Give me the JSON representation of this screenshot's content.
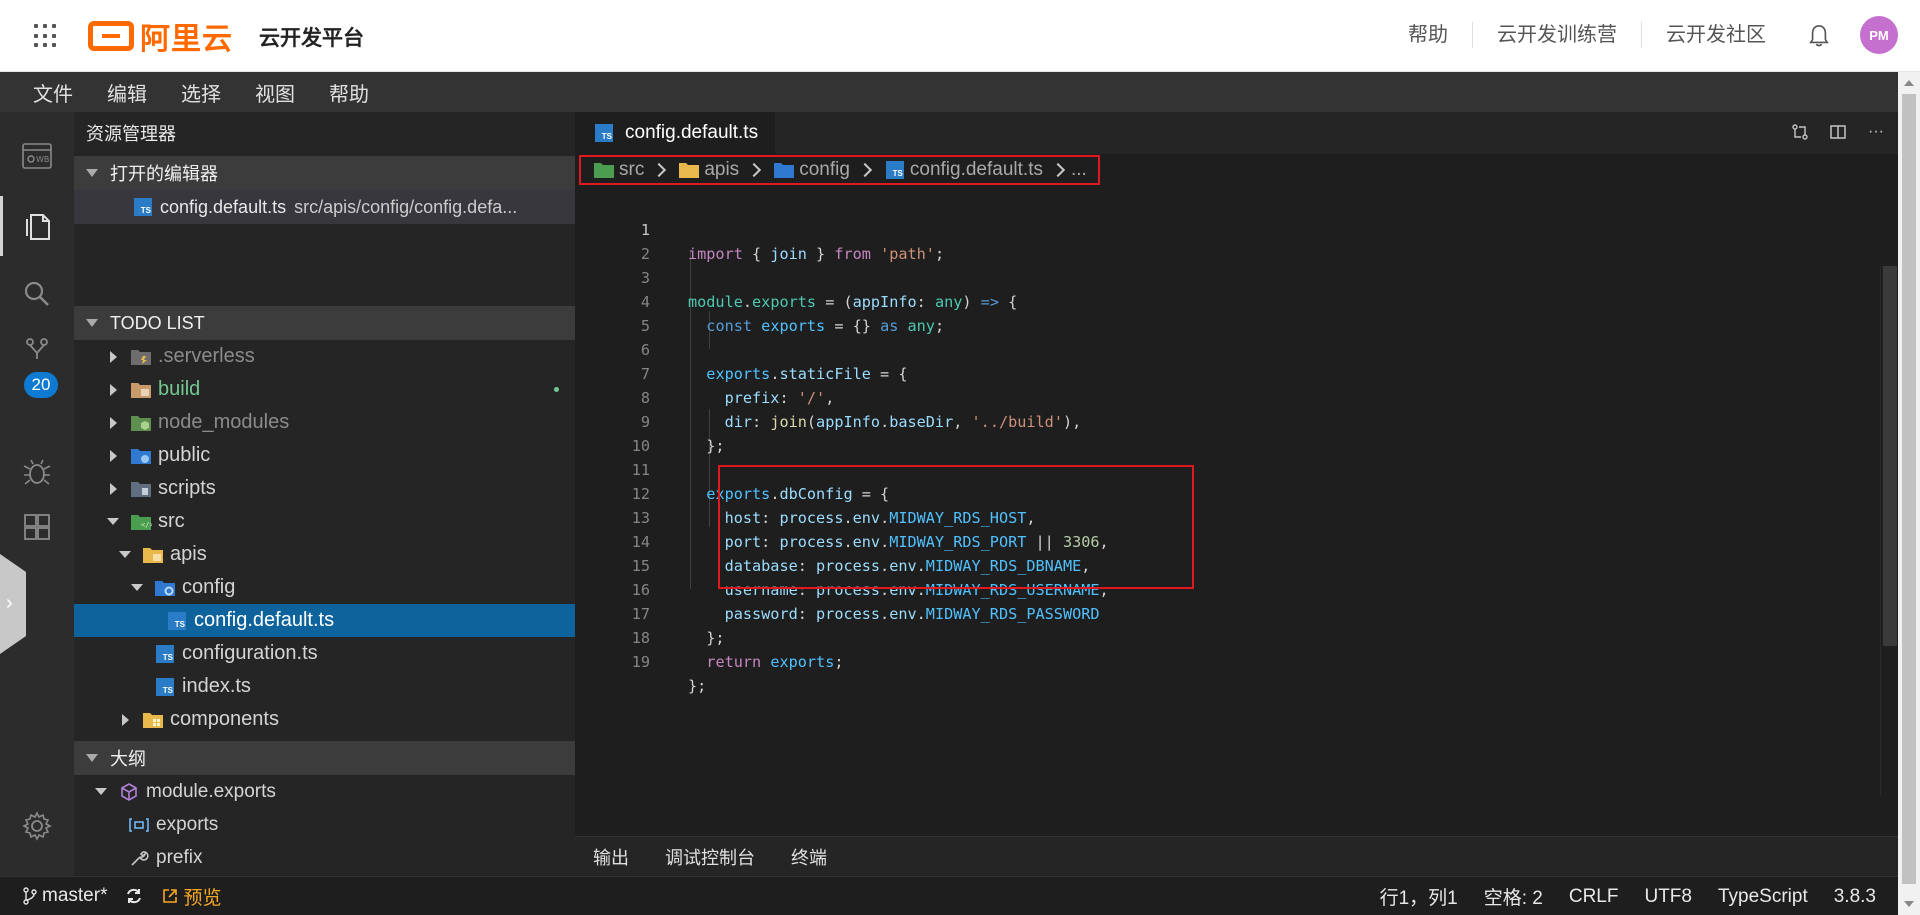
{
  "header": {
    "brand": "阿里云",
    "platform_title": "云开发平台",
    "links": [
      "帮助",
      "云开发训练营",
      "云开发社区"
    ],
    "avatar_initials": "PM",
    "avatar_color": "#c56fcf",
    "brand_color": "#ff6a00"
  },
  "menubar": {
    "items": [
      "文件",
      "编辑",
      "选择",
      "视图",
      "帮助"
    ]
  },
  "activitybar": {
    "icons": [
      "web-icon",
      "files-icon",
      "search-icon",
      "source-control-icon",
      "debug-icon",
      "extensions-icon",
      "settings-icon"
    ],
    "scm_badge": "20"
  },
  "sidebar": {
    "title": "资源管理器",
    "open_editors": {
      "header": "打开的编辑器",
      "file": "config.default.ts",
      "path": "src/apis/config/config.defa..."
    },
    "todo_list": {
      "header": "TODO LIST",
      "items": [
        {
          "label": ".serverless"
        },
        {
          "label": "build"
        },
        {
          "label": "node_modules"
        },
        {
          "label": "public"
        },
        {
          "label": "scripts"
        },
        {
          "label": "src"
        },
        {
          "label": "apis"
        },
        {
          "label": "config"
        },
        {
          "label": "config.default.ts"
        },
        {
          "label": "configuration.ts"
        },
        {
          "label": "index.ts"
        },
        {
          "label": "components"
        }
      ]
    },
    "outline": {
      "header": "大纲",
      "items": [
        "module.exports",
        "exports",
        "prefix"
      ]
    }
  },
  "editor": {
    "tab_label": "config.default.ts",
    "breadcrumb": [
      "src",
      "apis",
      "config",
      "config.default.ts",
      "..."
    ],
    "line_numbers": [
      "1",
      "2",
      "3",
      "4",
      "5",
      "6",
      "7",
      "8",
      "9",
      "10",
      "11",
      "12",
      "13",
      "14",
      "15",
      "16",
      "17",
      "18",
      "19"
    ],
    "code_lines": [
      "import { join } from 'path';",
      "",
      "module.exports = (appInfo: any) => {",
      "  const exports = {} as any;",
      "",
      "  exports.staticFile = {",
      "    prefix: '/',",
      "    dir: join(appInfo.baseDir, '../build'),",
      "  };",
      "",
      "  exports.dbConfig = {",
      "    host: process.env.MIDWAY_RDS_HOST,",
      "    port: process.env.MIDWAY_RDS_PORT || 3306,",
      "    database: process.env.MIDWAY_RDS_DBNAME,",
      "    username: process.env.MIDWAY_RDS_USERNAME,",
      "    password: process.env.MIDWAY_RDS_PASSWORD",
      "  };",
      "  return exports;",
      "};"
    ],
    "panel_tabs": [
      "输出",
      "调试控制台",
      "终端"
    ]
  },
  "statusbar": {
    "branch": "master*",
    "preview": "预览",
    "position": "行1，列1",
    "spaces": "空格: 2",
    "eol": "CRLF",
    "encoding": "UTF8",
    "language": "TypeScript",
    "version": "3.8.3"
  }
}
